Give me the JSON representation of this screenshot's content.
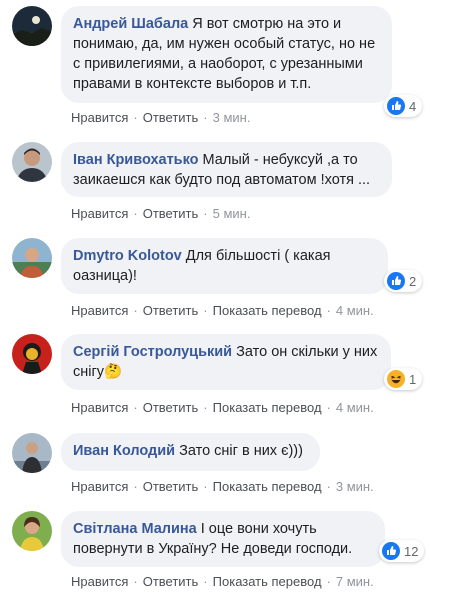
{
  "comments": [
    {
      "author": "Андрей Шабала",
      "text": "Я вот смотрю на это и понимаю, да, им нужен особый статус, но не с привилегиями, а наоборот, с урезанными правами в контексте выборов и т.п.",
      "reaction": {
        "type": "like-icon",
        "count": "4"
      },
      "actions": [
        "Нравится",
        "Ответить"
      ],
      "time": "3 мин."
    },
    {
      "author": "Іван Кривохатько",
      "text": "Малый - небуксуй ,а то заикаешся как будто под автоматом !хотя ...",
      "actions": [
        "Нравится",
        "Ответить"
      ],
      "time": "5 мин."
    },
    {
      "author": "Dmytro Kolotov",
      "text": "Для більшості ( какая оазница)!",
      "reaction": {
        "type": "like-icon",
        "count": "2"
      },
      "actions": [
        "Нравится",
        "Ответить",
        "Показать перевод"
      ],
      "time": "4 мин."
    },
    {
      "author": "Сергій Гостролуцький",
      "text": "Зато он скільки у них снігу🤔",
      "reaction": {
        "type": "haha-icon",
        "count": "1"
      },
      "actions": [
        "Нравится",
        "Ответить",
        "Показать перевод"
      ],
      "time": "4 мин."
    },
    {
      "author": "Иван Колодий",
      "text": "Зато сніг в них є)))",
      "actions": [
        "Нравится",
        "Ответить",
        "Показать перевод"
      ],
      "time": "3 мин."
    },
    {
      "author": "Світлана Малина",
      "text": "І оце вони хочуть повернути в Україну? Не доведи господи.",
      "reaction": {
        "type": "like-icon",
        "count": "12"
      },
      "actions": [
        "Нравится",
        "Ответить",
        "Показать перевод"
      ],
      "time": "7 мин."
    }
  ],
  "colors": {
    "author": "#385898",
    "bubble": "#f0f2f5",
    "like": "#1877f2",
    "haha": "#f7b125",
    "meta": "#65676b"
  }
}
